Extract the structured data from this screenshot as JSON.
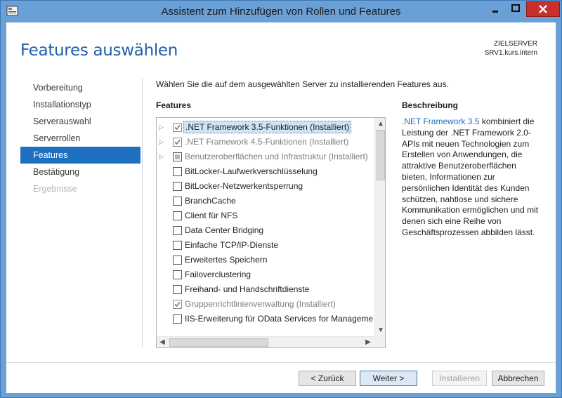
{
  "window": {
    "title": "Assistent zum Hinzufügen von Rollen und Features",
    "accent_color": "#6aa0d6",
    "close_color": "#c8302c"
  },
  "header": {
    "page_title": "Features auswählen",
    "server_caption": "ZIELSERVER",
    "server_name": "SRV1.kurs.intern"
  },
  "nav": {
    "items": [
      {
        "label": "Vorbereitung",
        "state": "normal"
      },
      {
        "label": "Installationstyp",
        "state": "normal"
      },
      {
        "label": "Serverauswahl",
        "state": "normal"
      },
      {
        "label": "Serverrollen",
        "state": "normal"
      },
      {
        "label": "Features",
        "state": "active"
      },
      {
        "label": "Bestätigung",
        "state": "normal"
      },
      {
        "label": "Ergebnisse",
        "state": "disabled"
      }
    ]
  },
  "main": {
    "instruction": "Wählen Sie die auf dem ausgewählten Server zu installierenden Features aus.",
    "features_heading": "Features",
    "features": [
      {
        "label": ".NET Framework 3.5-Funktionen (Installiert)",
        "state": "checked",
        "expandable": true,
        "installed": false,
        "selected": true
      },
      {
        "label": ".NET Framework 4.5-Funktionen (Installiert)",
        "state": "checked",
        "expandable": true,
        "installed": true
      },
      {
        "label": "Benutzeroberflächen und Infrastruktur (Installiert)",
        "state": "partial",
        "expandable": true,
        "installed": true
      },
      {
        "label": "BitLocker-Laufwerkverschlüsselung",
        "state": "unchecked"
      },
      {
        "label": "BitLocker-Netzwerkentsperrung",
        "state": "unchecked"
      },
      {
        "label": "BranchCache",
        "state": "unchecked"
      },
      {
        "label": "Client für NFS",
        "state": "unchecked"
      },
      {
        "label": "Data Center Bridging",
        "state": "unchecked"
      },
      {
        "label": "Einfache TCP/IP-Dienste",
        "state": "unchecked"
      },
      {
        "label": "Erweitertes Speichern",
        "state": "unchecked"
      },
      {
        "label": "Failoverclustering",
        "state": "unchecked"
      },
      {
        "label": "Freihand- und Handschriftdienste",
        "state": "unchecked"
      },
      {
        "label": "Gruppenrichtlinienverwaltung (Installiert)",
        "state": "checked",
        "installed": true
      },
      {
        "label": "IIS-Erweiterung für OData Services for Manageme",
        "state": "unchecked"
      }
    ],
    "description_heading": "Beschreibung",
    "description_link": ".NET Framework 3.5",
    "description_text": " kombiniert die Leistung der .NET Framework 2.0-APIs mit neuen Technologien zum Erstellen von Anwendungen, die attraktive Benutzeroberflächen bieten, Informationen zur persönlichen Identität des Kunden schützen, nahtlose und sichere Kommunikation ermöglichen und mit denen sich eine Reihe von Geschäftsprozessen abbilden lässt."
  },
  "footer": {
    "back_label": "< Zurück",
    "next_label": "Weiter >",
    "install_label": "Installieren",
    "cancel_label": "Abbrechen"
  }
}
